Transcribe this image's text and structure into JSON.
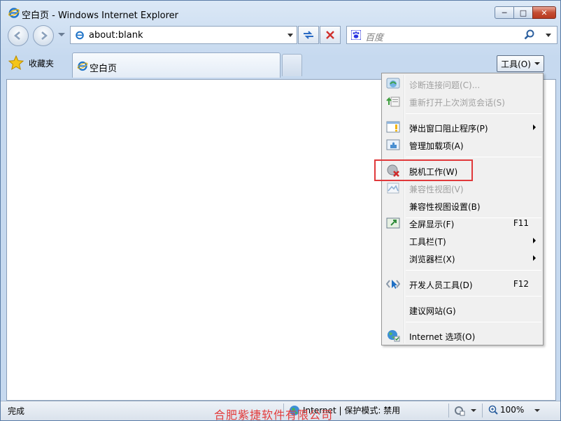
{
  "window": {
    "title": "空白页 - Windows Internet Explorer",
    "minimize_glyph": "─",
    "maximize_glyph": "□",
    "close_glyph": "✕"
  },
  "nav": {
    "address_value": "about:blank",
    "search_placeholder": "百度"
  },
  "toolbar": {
    "favorites_label": "收藏夹",
    "tab_title": "空白页",
    "tools_label": "工具(O)"
  },
  "status": {
    "text": "完成",
    "zone_text": "Internet | 保护模式: 禁用",
    "zoom": "100%"
  },
  "tools_menu": {
    "items": [
      {
        "label": "诊断连接问题(C)...",
        "icon": "diagnose-icon",
        "disabled": true
      },
      {
        "label": "重新打开上次浏览会话(S)",
        "icon": "reopen-session-icon",
        "disabled": true
      },
      {
        "label": "弹出窗口阻止程序(P)",
        "icon": "popup-blocker-icon",
        "submenu": true
      },
      {
        "label": "管理加载项(A)",
        "icon": "addons-icon"
      },
      {
        "label": "脱机工作(W)",
        "icon": "offline-icon",
        "highlighted": true
      },
      {
        "label": "兼容性视图(V)",
        "icon": "compat-view-icon",
        "disabled": true
      },
      {
        "label": "兼容性视图设置(B)"
      },
      {
        "label": "全屏显示(F)",
        "icon": "fullscreen-icon",
        "shortcut": "F11"
      },
      {
        "label": "工具栏(T)",
        "submenu": true
      },
      {
        "label": "浏览器栏(X)",
        "submenu": true
      },
      {
        "label": "开发人员工具(D)",
        "icon": "developer-tools-icon",
        "shortcut": "F12"
      },
      {
        "label": "建议网站(G)"
      },
      {
        "label": "Internet 选项(O)",
        "icon": "internet-options-icon"
      }
    ]
  },
  "watermark": "合肥紫捷软件有限公司",
  "colors": {
    "highlight_box": "#e0393b",
    "watermark": "#e33c3c",
    "close_button": "#c44d33"
  }
}
